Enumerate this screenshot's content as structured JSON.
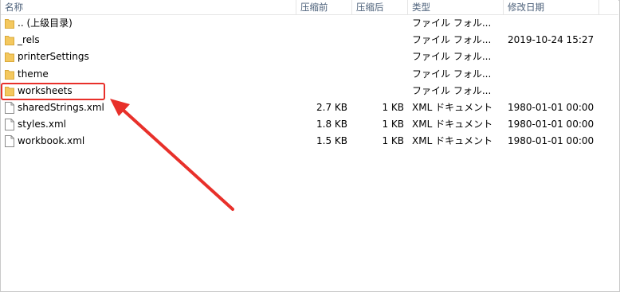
{
  "columns": {
    "name": "名称",
    "original_size": "压缩前",
    "compressed_size": "压缩后",
    "type": "类型",
    "modified": "修改日期"
  },
  "rows": [
    {
      "icon": "folder-icon",
      "name": ".. (上级目录)",
      "original_size": "",
      "compressed_size": "",
      "type": "ファイル フォル...",
      "modified": ""
    },
    {
      "icon": "folder-icon",
      "name": "_rels",
      "original_size": "",
      "compressed_size": "",
      "type": "ファイル フォル...",
      "modified": "2019-10-24 15:27"
    },
    {
      "icon": "folder-icon",
      "name": "printerSettings",
      "original_size": "",
      "compressed_size": "",
      "type": "ファイル フォル...",
      "modified": ""
    },
    {
      "icon": "folder-icon",
      "name": "theme",
      "original_size": "",
      "compressed_size": "",
      "type": "ファイル フォル...",
      "modified": ""
    },
    {
      "icon": "folder-icon",
      "name": "worksheets",
      "original_size": "",
      "compressed_size": "",
      "type": "ファイル フォル...",
      "modified": ""
    },
    {
      "icon": "file-icon",
      "name": "sharedStrings.xml",
      "original_size": "2.7 KB",
      "compressed_size": "1 KB",
      "type": "XML ドキュメント",
      "modified": "1980-01-01 00:00"
    },
    {
      "icon": "file-icon",
      "name": "styles.xml",
      "original_size": "1.8 KB",
      "compressed_size": "1 KB",
      "type": "XML ドキュメント",
      "modified": "1980-01-01 00:00"
    },
    {
      "icon": "file-icon",
      "name": "workbook.xml",
      "original_size": "1.5 KB",
      "compressed_size": "1 KB",
      "type": "XML ドキュメント",
      "modified": "1980-01-01 00:00"
    }
  ],
  "colors": {
    "highlight": "#e8302a",
    "folder": "#f4c85e",
    "header_text": "#4c607a"
  }
}
